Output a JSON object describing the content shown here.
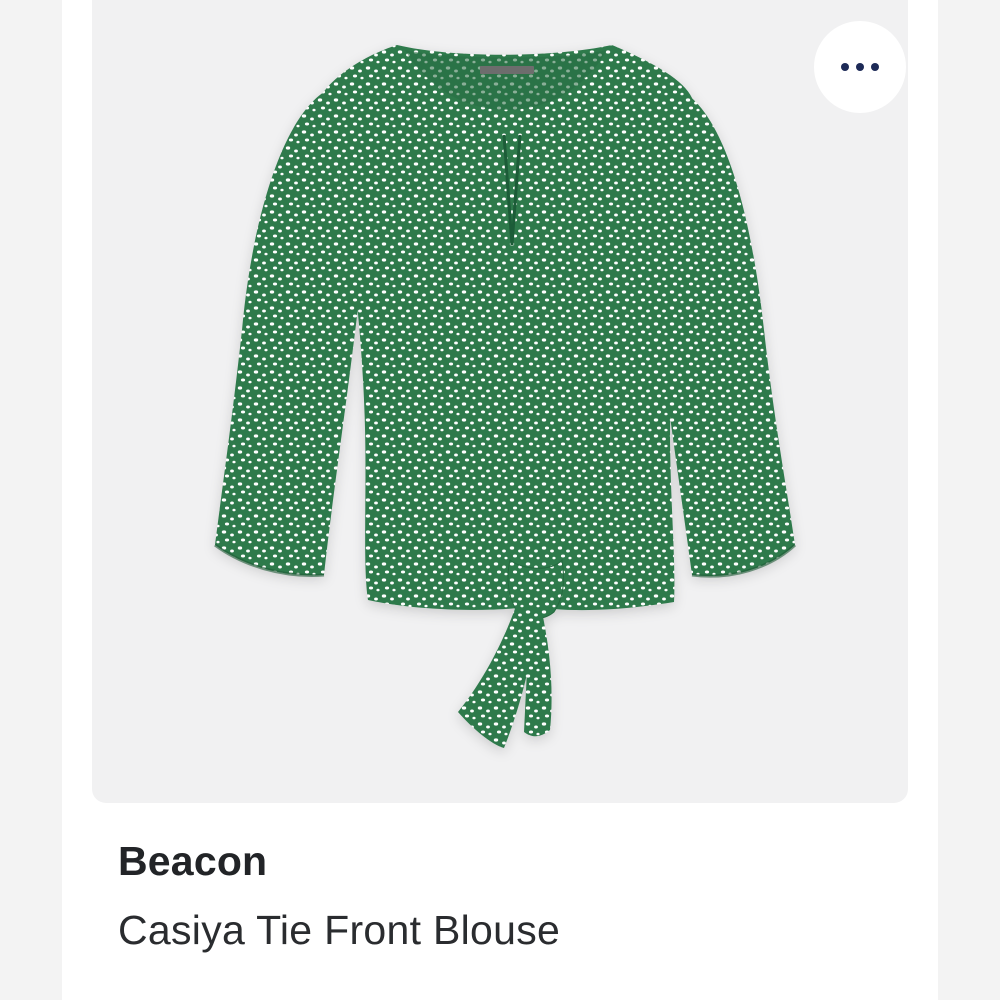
{
  "product": {
    "brand": "Beacon",
    "name": "Casiya Tie Front Blouse",
    "image_alt": "Green dotted tie front blouse"
  },
  "actions": {
    "more_label": "More options",
    "more_icon": "more-horizontal-icon"
  },
  "colors": {
    "garment": "#2f7a4c",
    "dot_color": "#ffffff",
    "icon_color": "#1d2a57",
    "image_background": "#f1f1f2"
  }
}
